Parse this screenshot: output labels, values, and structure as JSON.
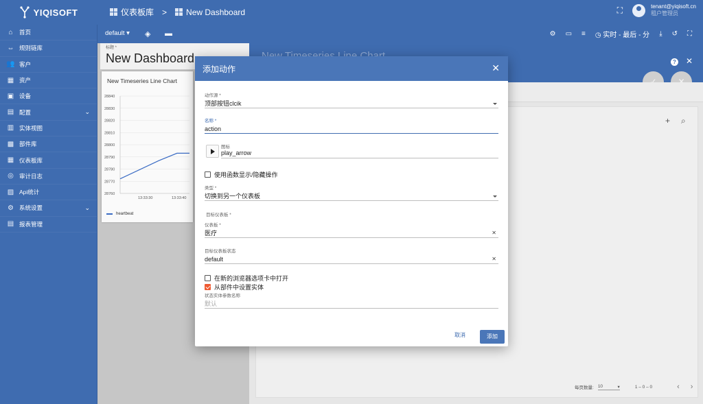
{
  "app": {
    "logo_text": "YIQISOFT"
  },
  "breadcrumb": {
    "item1": "仪表板库",
    "separator": ">",
    "item2": "New Dashboard"
  },
  "user": {
    "email": "tenant@yiqisoft.cn",
    "role": "租户管理员"
  },
  "sidebar": {
    "items": [
      {
        "label": "首页",
        "icon": "home-icon"
      },
      {
        "label": "规则链库",
        "icon": "rule-chain-icon"
      },
      {
        "label": "客户",
        "icon": "customers-icon"
      },
      {
        "label": "资产",
        "icon": "assets-icon"
      },
      {
        "label": "设备",
        "icon": "devices-icon"
      },
      {
        "label": "配置",
        "icon": "settings-icon",
        "expand": true
      },
      {
        "label": "实体视图",
        "icon": "entity-view-icon"
      },
      {
        "label": "部件库",
        "icon": "widgets-icon"
      },
      {
        "label": "仪表板库",
        "icon": "dashboards-icon"
      },
      {
        "label": "审计日志",
        "icon": "audit-icon"
      },
      {
        "label": "Api统计",
        "icon": "api-stats-icon"
      },
      {
        "label": "系统设置",
        "icon": "system-settings-icon",
        "expand": true
      },
      {
        "label": "报表管理",
        "icon": "reports-icon"
      }
    ]
  },
  "toolbar": {
    "state": "default",
    "timewindow": "实时 - 最后 - 分"
  },
  "dashboard": {
    "title_label": "标题 *",
    "title": "New Dashboard"
  },
  "widget": {
    "title": "New Timeseries Line Chart",
    "legend": "heartbeat"
  },
  "chart_data": {
    "type": "line",
    "title": "New Timeseries Line Chart",
    "x": [
      "13:33:30",
      "13:33:40"
    ],
    "ylim": [
      28760,
      28840
    ],
    "yticks": [
      28840,
      28830,
      28820,
      28810,
      28800,
      28790,
      28780,
      28770,
      28760
    ],
    "series": [
      {
        "name": "heartbeat",
        "points": [
          [
            0,
            28772
          ],
          [
            0.56,
            28787
          ],
          [
            0.82,
            28793
          ],
          [
            1,
            28793
          ]
        ]
      }
    ]
  },
  "right_panel": {
    "ghost_title": "New Timeseries Line Chart",
    "help": "?",
    "page_size_label": "每页数量:",
    "page_size": "10",
    "range": "1 – 0 – 0"
  },
  "dialog": {
    "title": "添加动作",
    "action_source_label": "动作源 *",
    "action_source": "顶部按钮clcik",
    "name_label": "名称 *",
    "name": "action",
    "icon_label": "图标",
    "icon": "play_arrow",
    "show_hide_fn": "使用函数显示/隐藏操作",
    "type_label": "类型 *",
    "type": "切换到另一个仪表板",
    "target_section": "目标仪表板 *",
    "dashboard_label": "仪表板 *",
    "dashboard": "医疗",
    "target_state_label": "目标仪表板状态",
    "target_state": "default",
    "open_new_tab": "在新的浏览器选项卡中打开",
    "set_entity": "从部件中设置实体",
    "state_entity_param_label": "状态实体参数名称",
    "state_entity_param_placeholder": "默认",
    "cancel": "取消",
    "add": "添加"
  }
}
